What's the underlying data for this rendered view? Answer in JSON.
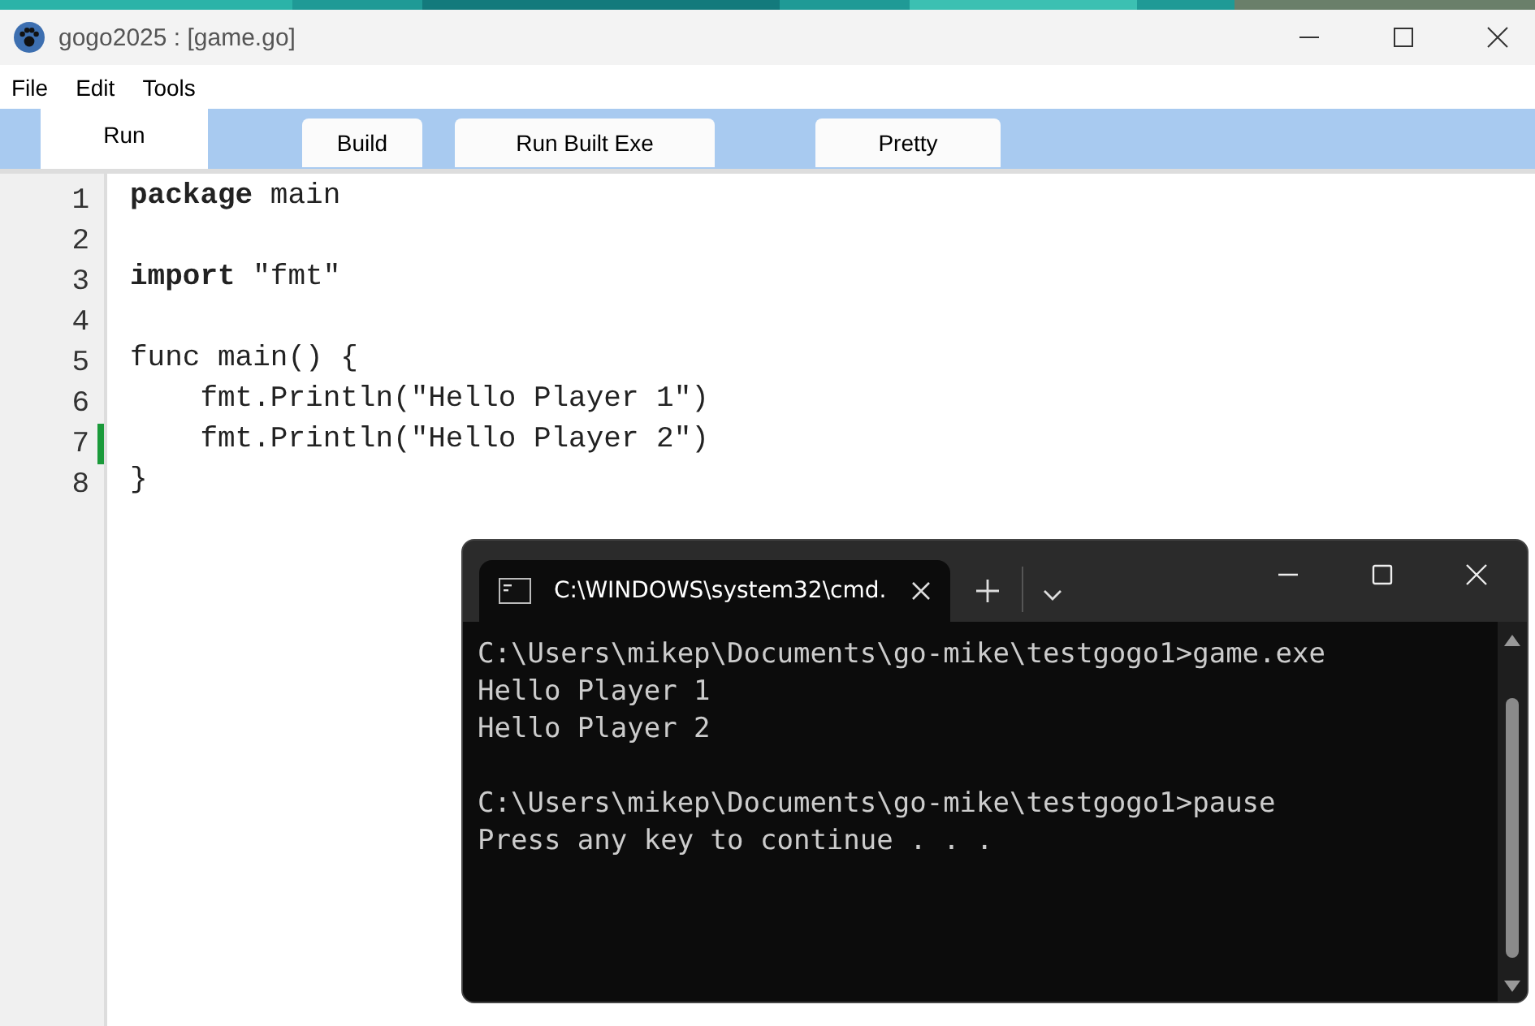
{
  "window": {
    "title": "gogo2025 : [game.go]"
  },
  "menu": [
    "File",
    "Edit",
    "Tools"
  ],
  "tabs": [
    {
      "label": "Run",
      "selected": true
    },
    {
      "label": "Build",
      "selected": false
    },
    {
      "label": "Run Built Exe",
      "selected": false
    },
    {
      "label": "Pretty",
      "selected": false
    }
  ],
  "editor": {
    "lines": [
      {
        "number": "1",
        "text": "**package** main",
        "modified": false
      },
      {
        "number": "2",
        "modified": false
      },
      {
        "number": "3",
        "text": "**import** \"fmt\"",
        "modified": false
      },
      {
        "number": "4",
        "modified": false
      },
      {
        "number": "5",
        "text": "func main() {",
        "modified": false
      },
      {
        "number": "6",
        "text": "    fmt.Println(\"Hello Player 1\")",
        "modified": false
      },
      {
        "number": "7",
        "text": "    fmt.Println(\"Hello Player 2\")",
        "modified": true
      },
      {
        "number": "8",
        "text": "}",
        "modified": false
      }
    ]
  },
  "terminal": {
    "tab_title": "C:\\WINDOWS\\system32\\cmd.",
    "output": [
      {
        "text": "C:\\Users\\mikep\\Documents\\go-mike\\testgogo1>game.exe"
      },
      {
        "text": "Hello Player 1"
      },
      {
        "text": "Hello Player 2"
      },
      {
        "blank": true
      },
      {
        "text": "C:\\Users\\mikep\\Documents\\go-mike\\testgogo1>pause"
      },
      {
        "text": "Press any key to continue . . ."
      }
    ]
  }
}
